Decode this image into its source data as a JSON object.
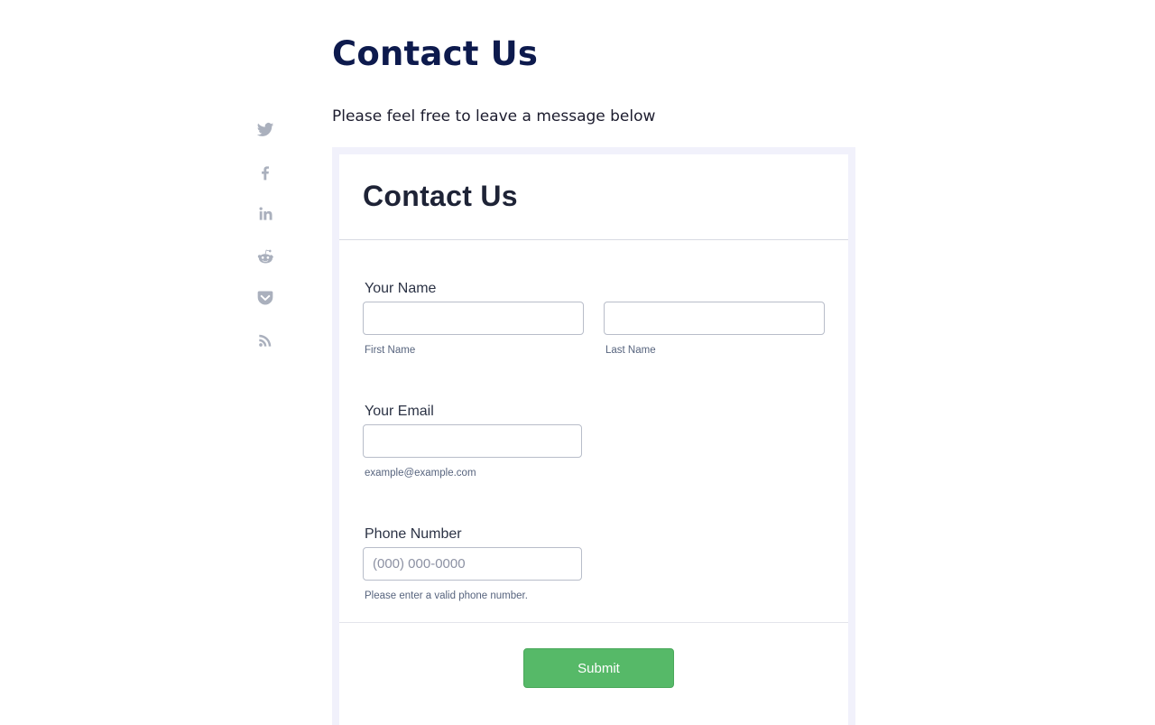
{
  "page": {
    "title": "Contact Us",
    "intro": "Please feel free to leave a message below"
  },
  "share": {
    "icons": [
      "twitter-icon",
      "facebook-icon",
      "linkedin-icon",
      "reddit-icon",
      "pocket-icon",
      "rss-icon"
    ],
    "icon_color": "#aab0bd"
  },
  "form": {
    "title": "Contact Us",
    "name": {
      "label": "Your Name",
      "first_value": "",
      "last_value": "",
      "first_sublabel": "First Name",
      "last_sublabel": "Last Name"
    },
    "email": {
      "label": "Your Email",
      "value": "",
      "sublabel": "example@example.com"
    },
    "phone": {
      "label": "Phone Number",
      "value": "",
      "placeholder": "(000) 000-0000",
      "sublabel": "Please enter a valid phone number."
    },
    "submit_label": "Submit",
    "submit_color": "#56b968"
  }
}
